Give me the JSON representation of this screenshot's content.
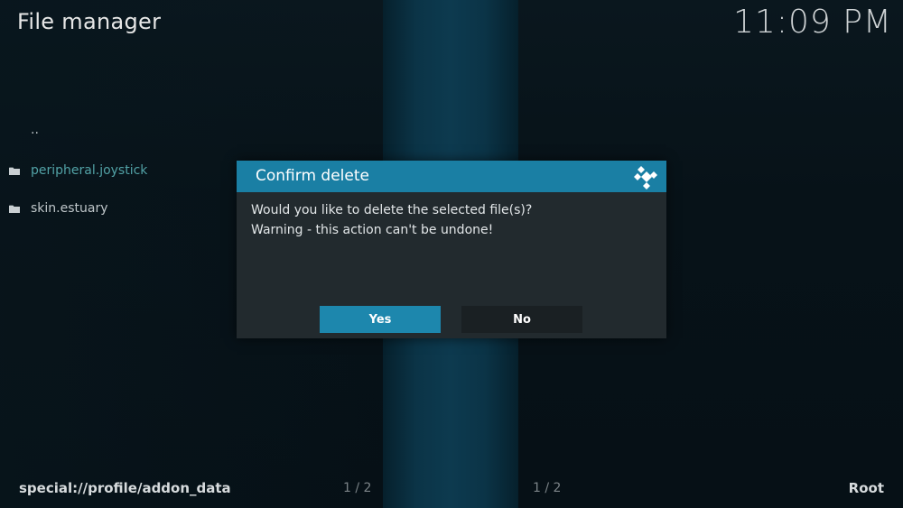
{
  "header": {
    "title": "File manager",
    "clock": "11:09 PM"
  },
  "file_list": {
    "parent": "..",
    "items": [
      {
        "label": "peripheral.joystick",
        "icon": "folder-icon",
        "focused": true
      },
      {
        "label": "skin.estuary",
        "icon": "folder-icon",
        "focused": false
      }
    ]
  },
  "dialog": {
    "title": "Confirm delete",
    "icon": "kodi-logo-icon",
    "line1": "Would you like to delete the selected file(s)?",
    "line2": "Warning - this action can't be undone!",
    "yes_label": "Yes",
    "no_label": "No"
  },
  "footer": {
    "path": "special://profile/addon_data",
    "page_left": "1 / 2",
    "page_right": "1 / 2",
    "root_label": "Root"
  },
  "colors": {
    "accent": "#1d87ad",
    "focused_text": "#52a2a6",
    "dialog_bg": "#222a2e"
  }
}
